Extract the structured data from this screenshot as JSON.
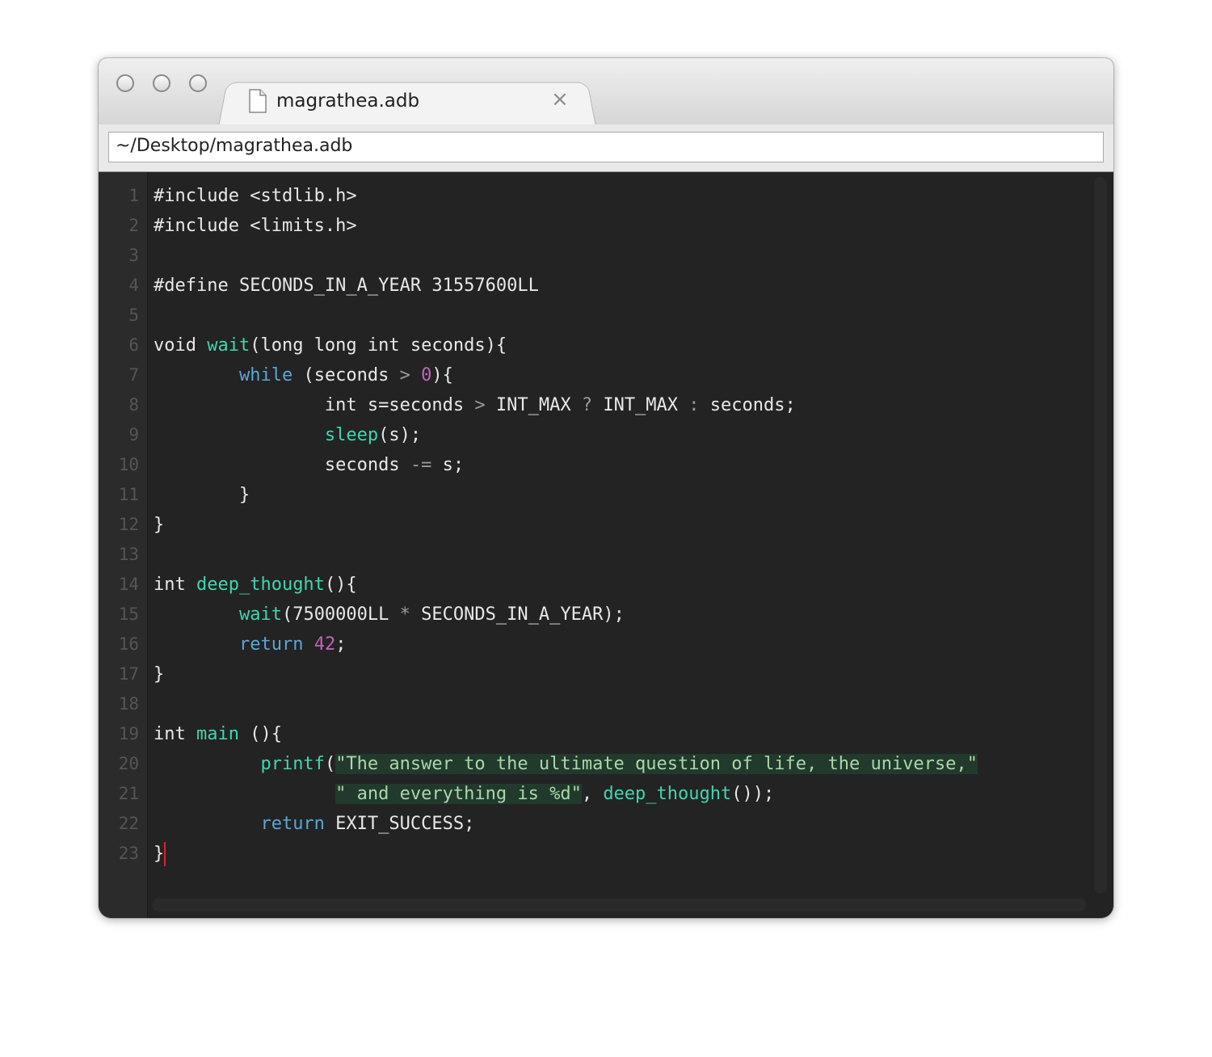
{
  "window": {
    "tab_title": "magrathea.adb",
    "tab_close_glyph": "×",
    "path": "~/Desktop/magrathea.adb"
  },
  "colors": {
    "keyword": "#5aa6d6",
    "function": "#3fd6b0",
    "number": "#c064b8",
    "string": "#a8d8a8",
    "caret": "#e0202a",
    "background": "#232323"
  },
  "editor": {
    "lines": [
      {
        "n": "1",
        "tokens": [
          {
            "t": "#include <stdlib.h>",
            "c": ""
          }
        ]
      },
      {
        "n": "2",
        "tokens": [
          {
            "t": "#include <limits.h>",
            "c": ""
          }
        ]
      },
      {
        "n": "3",
        "tokens": []
      },
      {
        "n": "4",
        "tokens": [
          {
            "t": "#define SECONDS_IN_A_YEAR 31557600LL",
            "c": ""
          }
        ]
      },
      {
        "n": "5",
        "tokens": []
      },
      {
        "n": "6",
        "tokens": [
          {
            "t": "void ",
            "c": ""
          },
          {
            "t": "wait",
            "c": "fn"
          },
          {
            "t": "(long long int seconds){",
            "c": ""
          }
        ]
      },
      {
        "n": "7",
        "tokens": [
          {
            "t": "        ",
            "c": ""
          },
          {
            "t": "while",
            "c": "kw"
          },
          {
            "t": " (seconds ",
            "c": ""
          },
          {
            "t": ">",
            "c": "op"
          },
          {
            "t": " ",
            "c": ""
          },
          {
            "t": "0",
            "c": "num"
          },
          {
            "t": "){",
            "c": ""
          }
        ]
      },
      {
        "n": "8",
        "tokens": [
          {
            "t": "                int s=seconds ",
            "c": ""
          },
          {
            "t": ">",
            "c": "op"
          },
          {
            "t": " INT_MAX ",
            "c": ""
          },
          {
            "t": "?",
            "c": "op"
          },
          {
            "t": " INT_MAX ",
            "c": ""
          },
          {
            "t": ":",
            "c": "op"
          },
          {
            "t": " seconds;",
            "c": ""
          }
        ]
      },
      {
        "n": "9",
        "tokens": [
          {
            "t": "                ",
            "c": ""
          },
          {
            "t": "sleep",
            "c": "fn"
          },
          {
            "t": "(s);",
            "c": ""
          }
        ]
      },
      {
        "n": "10",
        "tokens": [
          {
            "t": "                seconds ",
            "c": ""
          },
          {
            "t": "-=",
            "c": "op"
          },
          {
            "t": " s;",
            "c": ""
          }
        ]
      },
      {
        "n": "11",
        "tokens": [
          {
            "t": "        }",
            "c": ""
          }
        ]
      },
      {
        "n": "12",
        "tokens": [
          {
            "t": "}",
            "c": ""
          }
        ]
      },
      {
        "n": "13",
        "tokens": []
      },
      {
        "n": "14",
        "tokens": [
          {
            "t": "int ",
            "c": ""
          },
          {
            "t": "deep_thought",
            "c": "fn"
          },
          {
            "t": "(){",
            "c": ""
          }
        ]
      },
      {
        "n": "15",
        "tokens": [
          {
            "t": "        ",
            "c": ""
          },
          {
            "t": "wait",
            "c": "fn"
          },
          {
            "t": "(7500000LL ",
            "c": ""
          },
          {
            "t": "*",
            "c": "op"
          },
          {
            "t": " SECONDS_IN_A_YEAR);",
            "c": ""
          }
        ]
      },
      {
        "n": "16",
        "tokens": [
          {
            "t": "        ",
            "c": ""
          },
          {
            "t": "return",
            "c": "kw"
          },
          {
            "t": " ",
            "c": ""
          },
          {
            "t": "42",
            "c": "num"
          },
          {
            "t": ";",
            "c": ""
          }
        ]
      },
      {
        "n": "17",
        "tokens": [
          {
            "t": "}",
            "c": ""
          }
        ]
      },
      {
        "n": "18",
        "tokens": []
      },
      {
        "n": "19",
        "tokens": [
          {
            "t": "int ",
            "c": ""
          },
          {
            "t": "main",
            "c": "fn"
          },
          {
            "t": " (){",
            "c": ""
          }
        ]
      },
      {
        "n": "20",
        "tokens": [
          {
            "t": "          ",
            "c": ""
          },
          {
            "t": "printf",
            "c": "fn"
          },
          {
            "t": "(",
            "c": ""
          },
          {
            "t": "\"The answer to the ultimate question of life, the universe,\"",
            "c": "str"
          }
        ]
      },
      {
        "n": "21",
        "tokens": [
          {
            "t": "                 ",
            "c": ""
          },
          {
            "t": "\" and everything is %d\"",
            "c": "str"
          },
          {
            "t": ", ",
            "c": ""
          },
          {
            "t": "deep_thought",
            "c": "fn"
          },
          {
            "t": "());",
            "c": ""
          }
        ]
      },
      {
        "n": "22",
        "tokens": [
          {
            "t": "          ",
            "c": ""
          },
          {
            "t": "return",
            "c": "kw"
          },
          {
            "t": " EXIT_SUCCESS;",
            "c": ""
          }
        ]
      },
      {
        "n": "23",
        "tokens": [
          {
            "t": "}",
            "c": ""
          }
        ],
        "caret": true
      }
    ]
  }
}
